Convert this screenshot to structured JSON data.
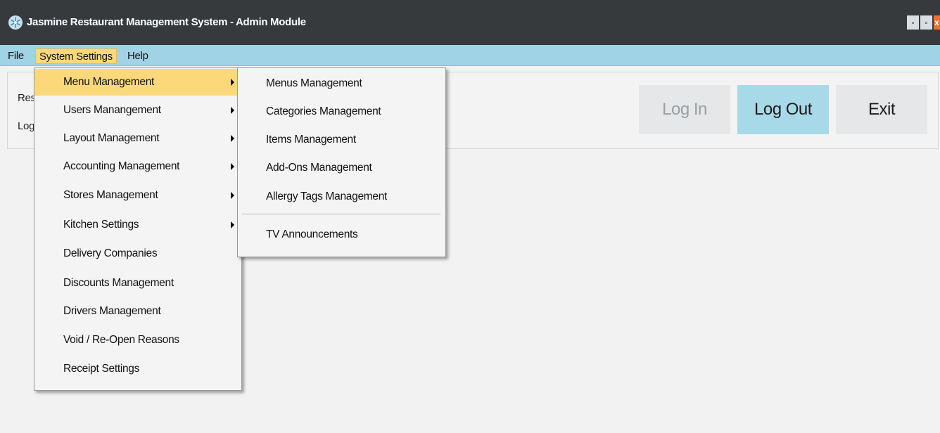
{
  "window": {
    "title": "Jasmine Restaurant Management System - Admin Module",
    "logo_icon": "snowflake-icon",
    "controls": {
      "minimize": "-",
      "maximize": "▫",
      "close": "x"
    }
  },
  "menubar": {
    "items": [
      "File",
      "System Settings",
      "Help"
    ]
  },
  "panel": {
    "labels": [
      "Res",
      "Log"
    ],
    "buttons": {
      "login": "Log In",
      "logout": "Log Out",
      "exit": "Exit"
    }
  },
  "system_settings_menu": {
    "items": [
      {
        "label": "Menu Management",
        "submenu": true
      },
      {
        "label": "Users Manangement",
        "submenu": true
      },
      {
        "label": "Layout Management",
        "submenu": true
      },
      {
        "label": "Accounting Management",
        "submenu": true
      },
      {
        "label": "Stores Management",
        "submenu": true
      },
      {
        "label": "Kitchen Settings",
        "submenu": true
      },
      {
        "label": "Delivery Companies",
        "submenu": false
      },
      {
        "label": "Discounts Management",
        "submenu": false
      },
      {
        "label": "Drivers Management",
        "submenu": false
      },
      {
        "label": "Void / Re-Open Reasons",
        "submenu": false
      },
      {
        "label": "Receipt Settings",
        "submenu": false
      }
    ]
  },
  "menu_management_submenu": {
    "items": [
      "Menus Management",
      "Categories Management",
      "Items Management",
      "Add-Ons Management",
      "Allergy Tags Management",
      "TV Announcements"
    ]
  },
  "colors": {
    "titlebar": "#373a3d",
    "menubar": "#9fd3e5",
    "highlight": "#fbd97a",
    "logout_button": "#a7d9e9",
    "close_button": "#e8742d"
  }
}
